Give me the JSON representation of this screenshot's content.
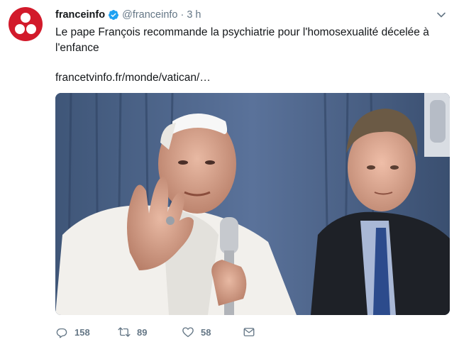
{
  "tweet": {
    "author_name": "franceinfo",
    "handle": "@franceinfo",
    "separator": "·",
    "time": "3 h",
    "text": "Le pape François recommande la psychiatrie pour l'homosexualité décelée à l'enfance",
    "link": "francetvinfo.fr/monde/vatican/…"
  },
  "actions": {
    "replies": "158",
    "retweets": "89",
    "likes": "58"
  },
  "colors": {
    "brand_red": "#d21a2b",
    "verified_blue": "#1da1f2",
    "muted": "#657786",
    "text": "#14171a"
  },
  "icons": {
    "avatar": "franceinfo-logo",
    "verified": "verified-badge-icon",
    "menu": "chevron-down-icon",
    "reply": "reply-icon",
    "retweet": "retweet-icon",
    "like": "heart-icon",
    "message": "envelope-icon"
  }
}
